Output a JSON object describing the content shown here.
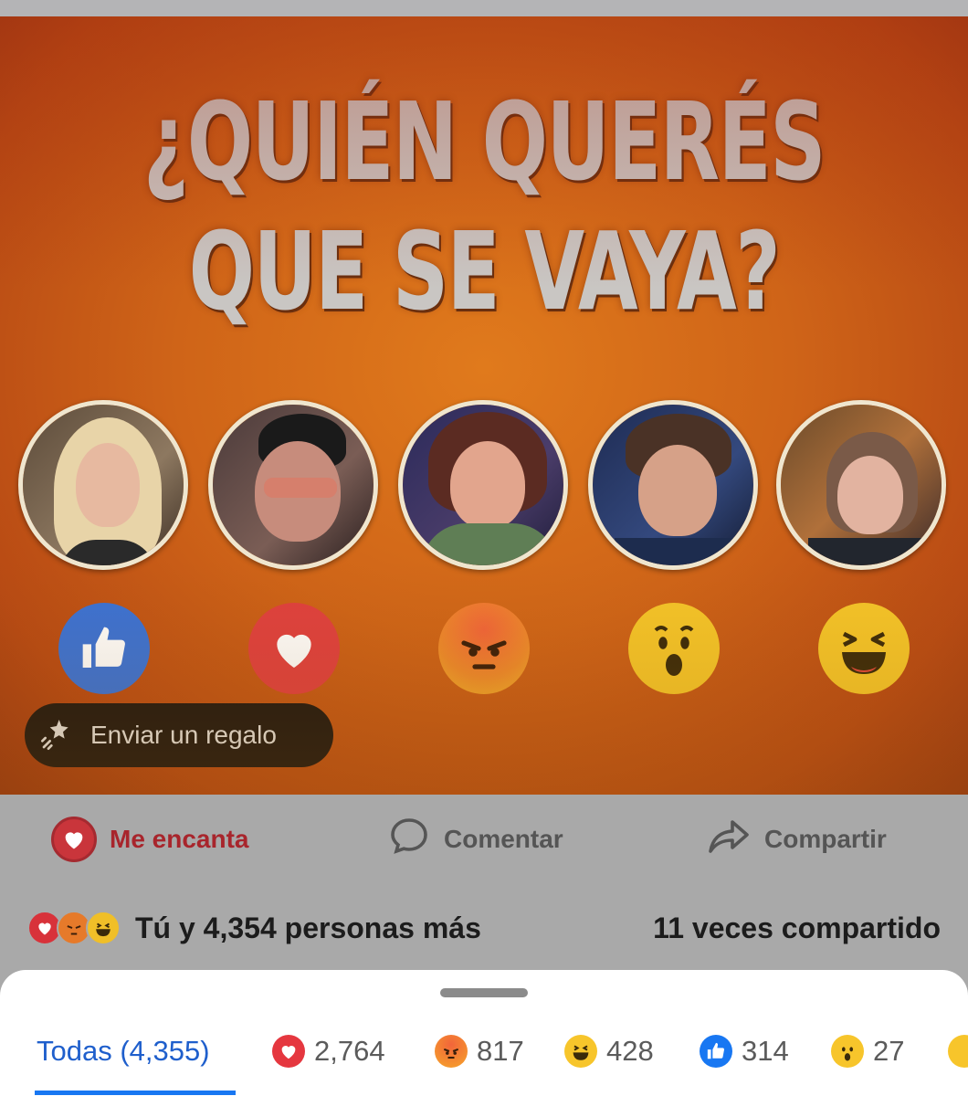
{
  "post": {
    "headline_line1": "¿QUIÉN QUERÉS",
    "headline_line2": "QUE SE VAYA?",
    "gift_button_label": "Enviar un regalo"
  },
  "colors": {
    "love_red": "#e5373f",
    "like_blue": "#1877f2",
    "emoji_yellow": "#f6c428",
    "sheet_bg": "#ffffff",
    "active_tab": "#1f5fcc"
  },
  "actions": {
    "love_label": "Me encanta",
    "comment_label": "Comentar",
    "share_label": "Compartir"
  },
  "summary": {
    "reactions_text": "Tú y 4,354 personas más",
    "shares_text": "11 veces compartido"
  },
  "reactions_sheet": {
    "tabs": [
      {
        "label": "Todas (4,355)",
        "icon": null
      },
      {
        "label": "2,764",
        "icon": "love-icon"
      },
      {
        "label": "817",
        "icon": "angry-icon"
      },
      {
        "label": "428",
        "icon": "haha-icon"
      },
      {
        "label": "314",
        "icon": "like-icon"
      },
      {
        "label": "27",
        "icon": "wow-icon"
      }
    ]
  }
}
